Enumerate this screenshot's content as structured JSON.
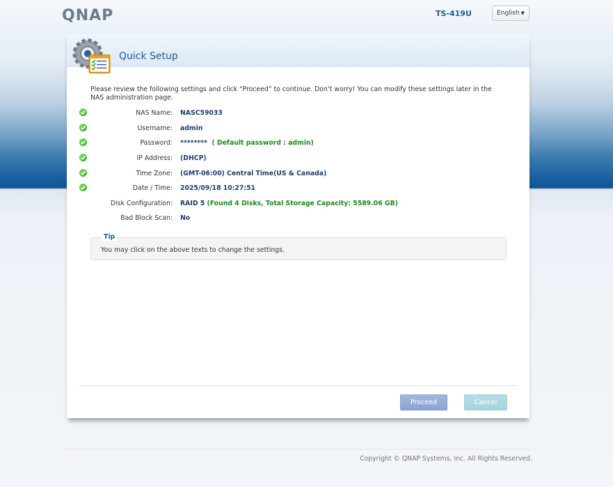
{
  "header": {
    "brand": "QNAP",
    "model": "TS-419U",
    "language": "English"
  },
  "panel": {
    "title": "Quick Setup",
    "intro": "Please review the following settings and click “Proceed” to continue. Don’t worry! You can modify these settings later in the NAS administration page.",
    "settings": [
      {
        "label": "NAS Name:",
        "value": "NASC59033",
        "checked": true
      },
      {
        "label": "Username:",
        "value": "admin",
        "checked": true
      },
      {
        "label": "Password:",
        "value": "********",
        "note": "( Default password  :  admin)",
        "checked": true
      },
      {
        "label": "IP Address:",
        "value": "(DHCP)",
        "checked": true
      },
      {
        "label": "Time Zone:",
        "value": "(GMT-06:00) Central Time(US & Canada)",
        "checked": true
      },
      {
        "label": "Date / Time:",
        "value": "2025/09/18 10:27:51",
        "checked": true
      },
      {
        "label": "Disk Configuration:",
        "value": "RAID 5",
        "note": "(Found 4 Disks, Total Storage Capacity: 5589.06 GB)",
        "checked": false
      },
      {
        "label": "Bad Block Scan:",
        "value": "No",
        "checked": false
      }
    ],
    "tip": {
      "title": "Tip",
      "text": "You may click on the above texts to change the settings."
    },
    "buttons": {
      "proceed": "Proceed",
      "cancel": "Cancel"
    }
  },
  "footer": {
    "copyright": "Copyright © QNAP Systems, Inc. All Rights Reserved."
  },
  "colors": {
    "accent": "#1d5c93",
    "value_text": "#1d3e6b",
    "green_note": "#1f8a1f",
    "band_blue": "#0f5695"
  }
}
